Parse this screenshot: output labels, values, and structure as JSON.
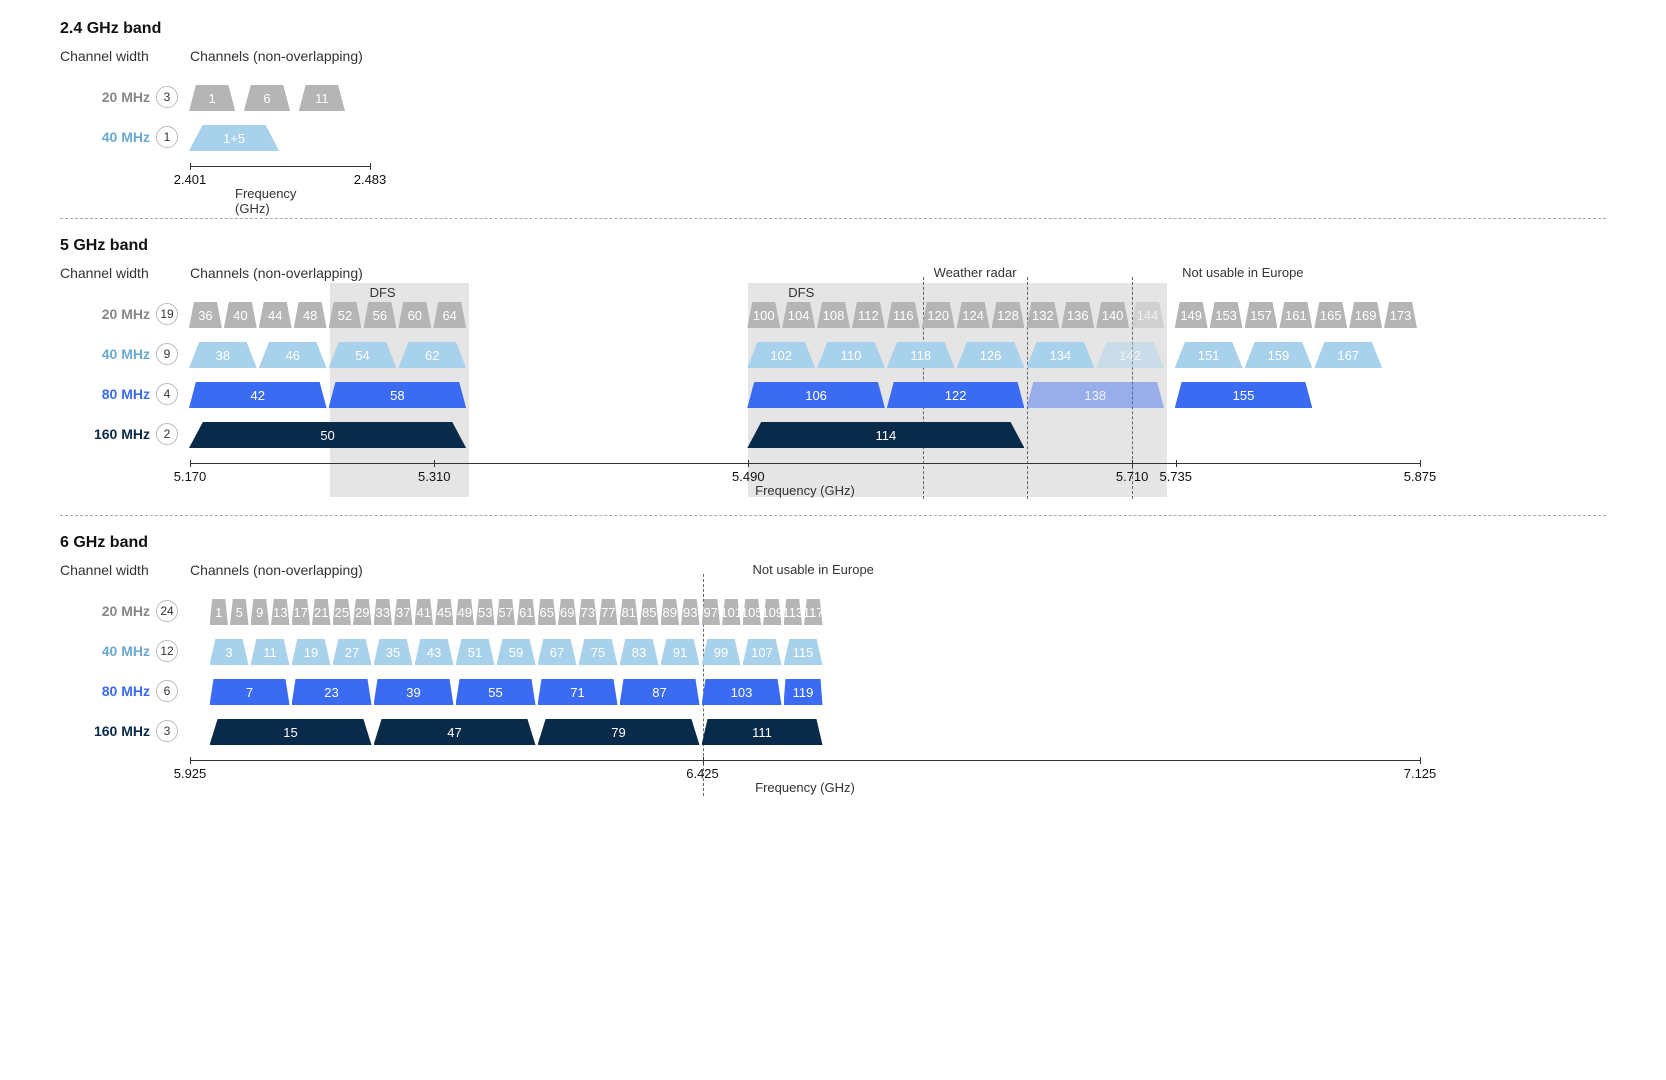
{
  "labels": {
    "channel_width": "Channel width",
    "channels_nonoverlap": "Channels (non-overlapping)",
    "frequency_axis": "Frequency (GHz)",
    "dfs": "DFS",
    "weather_radar": "Weather radar",
    "not_usable_europe": "Not usable in Europe"
  },
  "chart_data": {
    "type": "table",
    "bands": [
      {
        "name": "2.4 GHz band",
        "freq_start_ghz": 2.401,
        "freq_end_ghz": 2.483,
        "axis_ticks": [
          "2.401",
          "2.483"
        ],
        "widths": [
          {
            "label": "20 MHz",
            "count": 3,
            "color": "grey",
            "channels": [
              {
                "n": "1",
                "start": 2.401,
                "end": 2.423
              },
              {
                "n": "6",
                "start": 2.426,
                "end": 2.448
              },
              {
                "n": "11",
                "start": 2.451,
                "end": 2.473
              }
            ]
          },
          {
            "label": "40 MHz",
            "count": 1,
            "color": "light",
            "channels": [
              {
                "n": "1+5",
                "start": 2.401,
                "end": 2.443
              }
            ]
          }
        ]
      },
      {
        "name": "5 GHz band",
        "freq_start_ghz": 5.17,
        "freq_end_ghz": 5.875,
        "axis_ticks": [
          "5.170",
          "5.310",
          "5.490",
          "5.710",
          "5.735",
          "5.875"
        ],
        "axis_tick_vals": [
          5.17,
          5.31,
          5.49,
          5.71,
          5.735,
          5.875
        ],
        "dfs_regions": [
          {
            "start": 5.25,
            "end": 5.33
          },
          {
            "start": 5.49,
            "end": 5.73
          }
        ],
        "weather_radar": {
          "start": 5.59,
          "end": 5.65
        },
        "not_usable_europe_start": 5.71,
        "widths": [
          {
            "label": "20 MHz",
            "count": 19,
            "color": "grey",
            "channels": [
              {
                "n": "36",
                "start": 5.17,
                "end": 5.19
              },
              {
                "n": "40",
                "start": 5.19,
                "end": 5.21
              },
              {
                "n": "44",
                "start": 5.21,
                "end": 5.23
              },
              {
                "n": "48",
                "start": 5.23,
                "end": 5.25
              },
              {
                "n": "52",
                "start": 5.25,
                "end": 5.27
              },
              {
                "n": "56",
                "start": 5.27,
                "end": 5.29
              },
              {
                "n": "60",
                "start": 5.29,
                "end": 5.31
              },
              {
                "n": "64",
                "start": 5.31,
                "end": 5.33
              },
              {
                "n": "100",
                "start": 5.49,
                "end": 5.51
              },
              {
                "n": "104",
                "start": 5.51,
                "end": 5.53
              },
              {
                "n": "108",
                "start": 5.53,
                "end": 5.55
              },
              {
                "n": "112",
                "start": 5.55,
                "end": 5.57
              },
              {
                "n": "116",
                "start": 5.57,
                "end": 5.59
              },
              {
                "n": "120",
                "start": 5.59,
                "end": 5.61
              },
              {
                "n": "124",
                "start": 5.61,
                "end": 5.63
              },
              {
                "n": "128",
                "start": 5.63,
                "end": 5.65
              },
              {
                "n": "132",
                "start": 5.65,
                "end": 5.67
              },
              {
                "n": "136",
                "start": 5.67,
                "end": 5.69
              },
              {
                "n": "140",
                "start": 5.69,
                "end": 5.71
              },
              {
                "n": "144",
                "start": 5.71,
                "end": 5.73,
                "faded": true
              },
              {
                "n": "149",
                "start": 5.735,
                "end": 5.755
              },
              {
                "n": "153",
                "start": 5.755,
                "end": 5.775
              },
              {
                "n": "157",
                "start": 5.775,
                "end": 5.795
              },
              {
                "n": "161",
                "start": 5.795,
                "end": 5.815
              },
              {
                "n": "165",
                "start": 5.815,
                "end": 5.835
              },
              {
                "n": "169",
                "start": 5.835,
                "end": 5.855
              },
              {
                "n": "173",
                "start": 5.855,
                "end": 5.875
              }
            ]
          },
          {
            "label": "40 MHz",
            "count": 9,
            "color": "light",
            "channels": [
              {
                "n": "38",
                "start": 5.17,
                "end": 5.21
              },
              {
                "n": "46",
                "start": 5.21,
                "end": 5.25
              },
              {
                "n": "54",
                "start": 5.25,
                "end": 5.29
              },
              {
                "n": "62",
                "start": 5.29,
                "end": 5.33
              },
              {
                "n": "102",
                "start": 5.49,
                "end": 5.53
              },
              {
                "n": "110",
                "start": 5.53,
                "end": 5.57
              },
              {
                "n": "118",
                "start": 5.57,
                "end": 5.61
              },
              {
                "n": "126",
                "start": 5.61,
                "end": 5.65
              },
              {
                "n": "134",
                "start": 5.65,
                "end": 5.69
              },
              {
                "n": "142",
                "start": 5.69,
                "end": 5.73,
                "faded": true
              },
              {
                "n": "151",
                "start": 5.735,
                "end": 5.775
              },
              {
                "n": "159",
                "start": 5.775,
                "end": 5.815
              },
              {
                "n": "167",
                "start": 5.815,
                "end": 5.855
              }
            ]
          },
          {
            "label": "80 MHz",
            "count": 4,
            "color": "mid",
            "channels": [
              {
                "n": "42",
                "start": 5.17,
                "end": 5.25
              },
              {
                "n": "58",
                "start": 5.25,
                "end": 5.33
              },
              {
                "n": "106",
                "start": 5.49,
                "end": 5.57
              },
              {
                "n": "122",
                "start": 5.57,
                "end": 5.65
              },
              {
                "n": "138",
                "start": 5.65,
                "end": 5.73,
                "faded": true
              },
              {
                "n": "155",
                "start": 5.735,
                "end": 5.815
              }
            ]
          },
          {
            "label": "160 MHz",
            "count": 2,
            "color": "dark",
            "channels": [
              {
                "n": "50",
                "start": 5.17,
                "end": 5.33
              },
              {
                "n": "114",
                "start": 5.49,
                "end": 5.65
              }
            ]
          }
        ]
      },
      {
        "name": "6 GHz band",
        "freq_start_ghz": 5.925,
        "freq_end_ghz": 7.125,
        "axis_ticks": [
          "5.925",
          "6.425",
          "7.125"
        ],
        "axis_tick_vals": [
          5.925,
          6.425,
          7.125
        ],
        "not_usable_europe_start": 6.425,
        "widths": [
          {
            "label": "20 MHz",
            "count": 24,
            "color": "grey",
            "channels": [
              {
                "n": "1",
                "start": 5.945,
                "end": 5.965
              },
              {
                "n": "5",
                "start": 5.965,
                "end": 5.985
              },
              {
                "n": "9",
                "start": 5.985,
                "end": 6.005
              },
              {
                "n": "13",
                "start": 6.005,
                "end": 6.025
              },
              {
                "n": "17",
                "start": 6.025,
                "end": 6.045
              },
              {
                "n": "21",
                "start": 6.045,
                "end": 6.065
              },
              {
                "n": "25",
                "start": 6.065,
                "end": 6.085
              },
              {
                "n": "29",
                "start": 6.085,
                "end": 6.105
              },
              {
                "n": "33",
                "start": 6.105,
                "end": 6.125
              },
              {
                "n": "37",
                "start": 6.125,
                "end": 6.145
              },
              {
                "n": "41",
                "start": 6.145,
                "end": 6.165
              },
              {
                "n": "45",
                "start": 6.165,
                "end": 6.185
              },
              {
                "n": "49",
                "start": 6.185,
                "end": 6.205
              },
              {
                "n": "53",
                "start": 6.205,
                "end": 6.225
              },
              {
                "n": "57",
                "start": 6.225,
                "end": 6.245
              },
              {
                "n": "61",
                "start": 6.245,
                "end": 6.265
              },
              {
                "n": "65",
                "start": 6.265,
                "end": 6.285
              },
              {
                "n": "69",
                "start": 6.285,
                "end": 6.305
              },
              {
                "n": "73",
                "start": 6.305,
                "end": 6.325
              },
              {
                "n": "77",
                "start": 6.325,
                "end": 6.345
              },
              {
                "n": "81",
                "start": 6.345,
                "end": 6.365
              },
              {
                "n": "85",
                "start": 6.365,
                "end": 6.385
              },
              {
                "n": "89",
                "start": 6.385,
                "end": 6.405
              },
              {
                "n": "93",
                "start": 6.405,
                "end": 6.425
              },
              {
                "n": "97",
                "start": 6.425,
                "end": 6.445
              },
              {
                "n": "101",
                "start": 6.445,
                "end": 6.465
              },
              {
                "n": "105",
                "start": 6.465,
                "end": 6.485
              },
              {
                "n": "109",
                "start": 6.485,
                "end": 6.505
              },
              {
                "n": "113",
                "start": 6.505,
                "end": 6.525
              },
              {
                "n": "117",
                "start": 6.525,
                "end": 6.545
              }
            ]
          },
          {
            "label": "40 MHz",
            "count": 12,
            "color": "light",
            "channels": [
              {
                "n": "3",
                "start": 5.945,
                "end": 5.985
              },
              {
                "n": "11",
                "start": 5.985,
                "end": 6.025
              },
              {
                "n": "19",
                "start": 6.025,
                "end": 6.065
              },
              {
                "n": "27",
                "start": 6.065,
                "end": 6.105
              },
              {
                "n": "35",
                "start": 6.105,
                "end": 6.145
              },
              {
                "n": "43",
                "start": 6.145,
                "end": 6.185
              },
              {
                "n": "51",
                "start": 6.185,
                "end": 6.225
              },
              {
                "n": "59",
                "start": 6.225,
                "end": 6.265
              },
              {
                "n": "67",
                "start": 6.265,
                "end": 6.305
              },
              {
                "n": "75",
                "start": 6.305,
                "end": 6.345
              },
              {
                "n": "83",
                "start": 6.345,
                "end": 6.385
              },
              {
                "n": "91",
                "start": 6.385,
                "end": 6.425
              },
              {
                "n": "99",
                "start": 6.425,
                "end": 6.465
              },
              {
                "n": "107",
                "start": 6.465,
                "end": 6.505
              },
              {
                "n": "115",
                "start": 6.505,
                "end": 6.545
              }
            ]
          },
          {
            "label": "80 MHz",
            "count": 6,
            "color": "mid",
            "channels": [
              {
                "n": "7",
                "start": 5.945,
                "end": 6.025
              },
              {
                "n": "23",
                "start": 6.025,
                "end": 6.105
              },
              {
                "n": "39",
                "start": 6.105,
                "end": 6.185
              },
              {
                "n": "55",
                "start": 6.185,
                "end": 6.265
              },
              {
                "n": "71",
                "start": 6.265,
                "end": 6.345
              },
              {
                "n": "87",
                "start": 6.345,
                "end": 6.425
              },
              {
                "n": "103",
                "start": 6.425,
                "end": 6.505
              },
              {
                "n": "119",
                "start": 6.505,
                "end": 6.545
              }
            ]
          },
          {
            "label": "160 MHz",
            "count": 3,
            "color": "dark",
            "channels": [
              {
                "n": "15",
                "start": 5.945,
                "end": 6.105
              },
              {
                "n": "47",
                "start": 6.105,
                "end": 6.265
              },
              {
                "n": "79",
                "start": 6.265,
                "end": 6.425
              },
              {
                "n": "111",
                "start": 6.425,
                "end": 6.545
              }
            ]
          }
        ]
      }
    ]
  }
}
